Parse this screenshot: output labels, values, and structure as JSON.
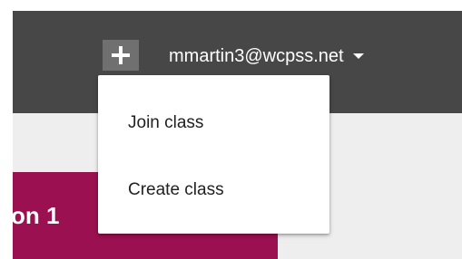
{
  "header": {
    "add_button_icon": "plus-icon",
    "account_email": "mmartin3@wcpss.net",
    "account_caret_icon": "caret-down-icon",
    "background_color": "#474747"
  },
  "add_menu": {
    "items": [
      {
        "label": "Join class"
      },
      {
        "label": "Create class"
      }
    ]
  },
  "class_card": {
    "title_visible": "on 1",
    "color": "#9b1050"
  }
}
